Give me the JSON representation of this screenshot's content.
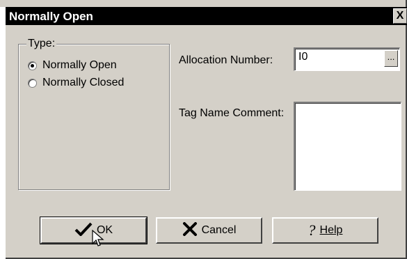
{
  "window": {
    "title": "Normally Open",
    "close_label": "X"
  },
  "type_group": {
    "label": "Type:",
    "options": [
      {
        "label": "Normally Open",
        "checked": true
      },
      {
        "label": "Normally Closed",
        "checked": false
      }
    ]
  },
  "allocation": {
    "label": "Allocation Number:",
    "value": "I0",
    "browse_label": "..."
  },
  "tag_comment": {
    "label": "Tag Name Comment:",
    "value": ""
  },
  "buttons": {
    "ok": "OK",
    "cancel": "Cancel",
    "help": "Help"
  },
  "icons": {
    "ok": "checkmark-icon",
    "cancel": "x-icon",
    "help": "question-mark-icon"
  }
}
